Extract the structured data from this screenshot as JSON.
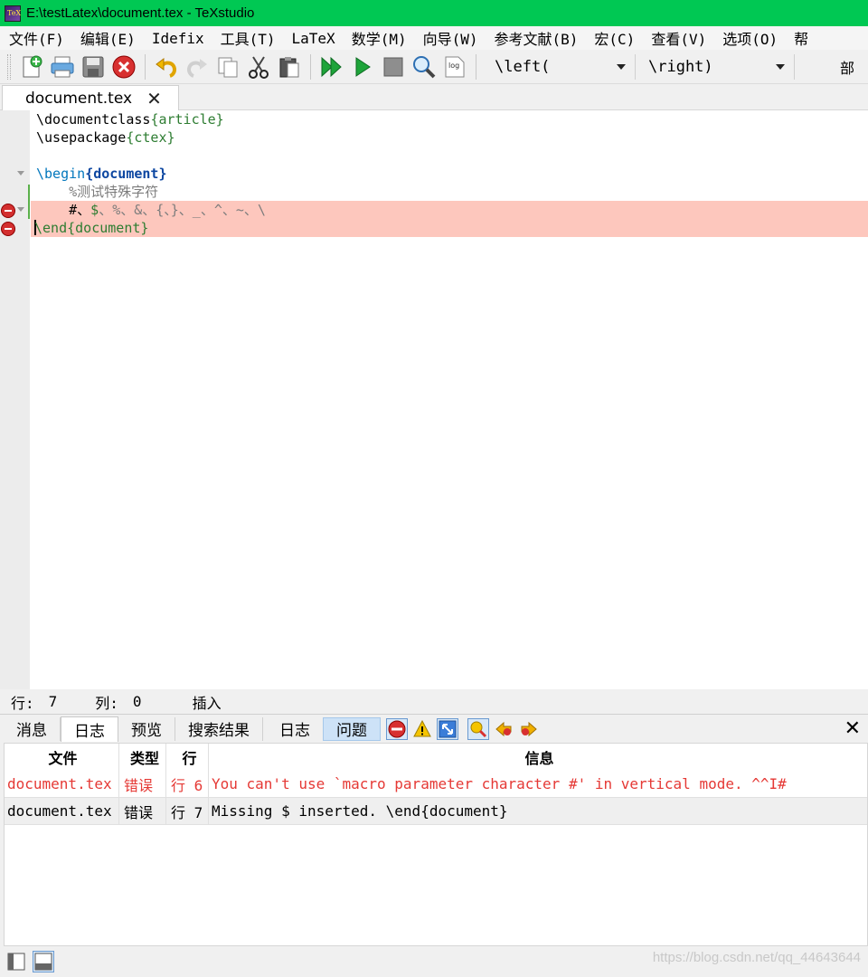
{
  "window": {
    "title": "E:\\testLatex\\document.tex - TeXstudio",
    "app_icon": "texstudio-icon"
  },
  "menubar": {
    "items": [
      "文件(F)",
      "编辑(E)",
      "Idefix",
      "工具(T)",
      "LaTeX",
      "数学(M)",
      "向导(W)",
      "参考文献(B)",
      "宏(C)",
      "查看(V)",
      "选项(O)",
      "帮"
    ]
  },
  "toolbar": {
    "buttons": [
      "new-file-icon",
      "print-icon",
      "save-icon",
      "close-file-icon",
      "undo-icon",
      "redo-icon",
      "copy-icon",
      "cut-icon",
      "paste-icon",
      "build-view-icon",
      "compile-icon",
      "stop-icon",
      "view-icon",
      "log-icon"
    ],
    "log_label": "log",
    "left_delim": "\\left(",
    "right_delim": "\\right)",
    "more_label": "部"
  },
  "tabs": {
    "document": "document.tex",
    "close_glyph": "✕"
  },
  "editor": {
    "lines": [
      {
        "cmd": "\\documentclass",
        "arg": "{article}"
      },
      {
        "cmd": "\\usepackage",
        "arg": "{ctex}"
      },
      {
        "cmd": "",
        "arg": ""
      },
      {
        "cmd": "\\begin",
        "arg": "{document}"
      },
      {
        "comment": "%测试特殊字符"
      },
      {
        "text_a": "#、",
        "dollar": "$",
        "text_b": "、%、&、{、}、_、^、~、\\"
      },
      {
        "cmd": "\\end",
        "arg": "{document}"
      }
    ]
  },
  "statusbar": {
    "line_label": "行:",
    "line_value": "7",
    "col_label": "列:",
    "col_value": "0",
    "mode": "插入"
  },
  "panel": {
    "tabs": [
      "消息",
      "日志",
      "预览",
      "搜索结果"
    ],
    "log_label": "日志",
    "problems_label": "问题",
    "close_glyph": "✕"
  },
  "results": {
    "headers": {
      "file": "文件",
      "type": "类型",
      "line": "行",
      "message": "信息"
    },
    "rows": [
      {
        "file": "document.tex",
        "type": "错误",
        "line": "行 6",
        "message": "You can't use `macro parameter character #' in vertical mode. ^^I#"
      },
      {
        "file": "document.tex",
        "type": "错误",
        "line": "行 7",
        "message": "Missing $ inserted. \\end{document}"
      }
    ]
  },
  "watermark": "https://blog.csdn.net/qq_44643644",
  "colors": {
    "titlebar": "#00c853",
    "error_line": "#fdc7bd",
    "error_text": "#e53935",
    "keyword": "#2e7d32"
  }
}
